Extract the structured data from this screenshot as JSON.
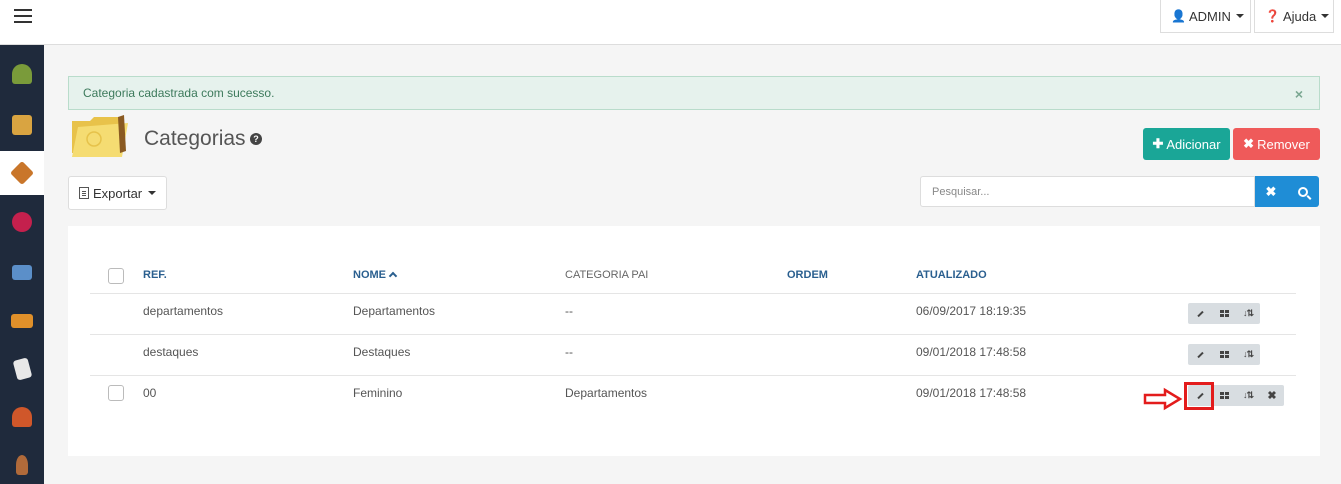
{
  "topbar": {
    "user_label": "ADMIN",
    "help_label": "Ajuda"
  },
  "sidebar": {
    "items": [
      {
        "icon": "orders-icon",
        "color": "#7a9b3a"
      },
      {
        "icon": "products-icon",
        "color": "#d9a441"
      },
      {
        "icon": "categories-icon",
        "color": "#c9762a",
        "active": true
      },
      {
        "icon": "promotions-icon",
        "color": "#c4204d"
      },
      {
        "icon": "banners-icon",
        "color": "#5b8fc9"
      },
      {
        "icon": "shipping-icon",
        "color": "#e0902a"
      },
      {
        "icon": "pages-icon",
        "color": "#e8e8e8"
      },
      {
        "icon": "customers-icon",
        "color": "#d0572a"
      },
      {
        "icon": "users-icon",
        "color": "#b06a3a"
      }
    ]
  },
  "alert": {
    "message": "Categoria cadastrada com sucesso.",
    "close": "×"
  },
  "page": {
    "title": "Categorias",
    "help": "?"
  },
  "toolbar": {
    "add_label": "Adicionar",
    "add_icon": "✚",
    "remove_label": "Remover",
    "remove_icon": "✖",
    "export_label": "Exportar"
  },
  "search": {
    "placeholder": "Pesquisar...",
    "clear": "✖"
  },
  "table": {
    "columns": [
      "REF.",
      "NOME",
      "CATEGORIA PAI",
      "ORDEM",
      "ATUALIZADO"
    ],
    "rows": [
      {
        "ref": "departamentos",
        "nome": "Departamentos",
        "pai": "--",
        "ordem": "",
        "atualizado": "06/09/2017 18:19:35"
      },
      {
        "ref": "destaques",
        "nome": "Destaques",
        "pai": "--",
        "ordem": "",
        "atualizado": "09/01/2018 17:48:58"
      },
      {
        "ref": "00",
        "nome": "Feminino",
        "pai": "Departamentos",
        "ordem": "",
        "atualizado": "09/01/2018 17:48:58"
      }
    ]
  },
  "colors": {
    "accent_green": "#1aa697",
    "accent_red": "#ef5a5a",
    "accent_blue": "#1f8dd6",
    "header_blue": "#2a5f8f",
    "highlight_red": "#e31c1c"
  }
}
